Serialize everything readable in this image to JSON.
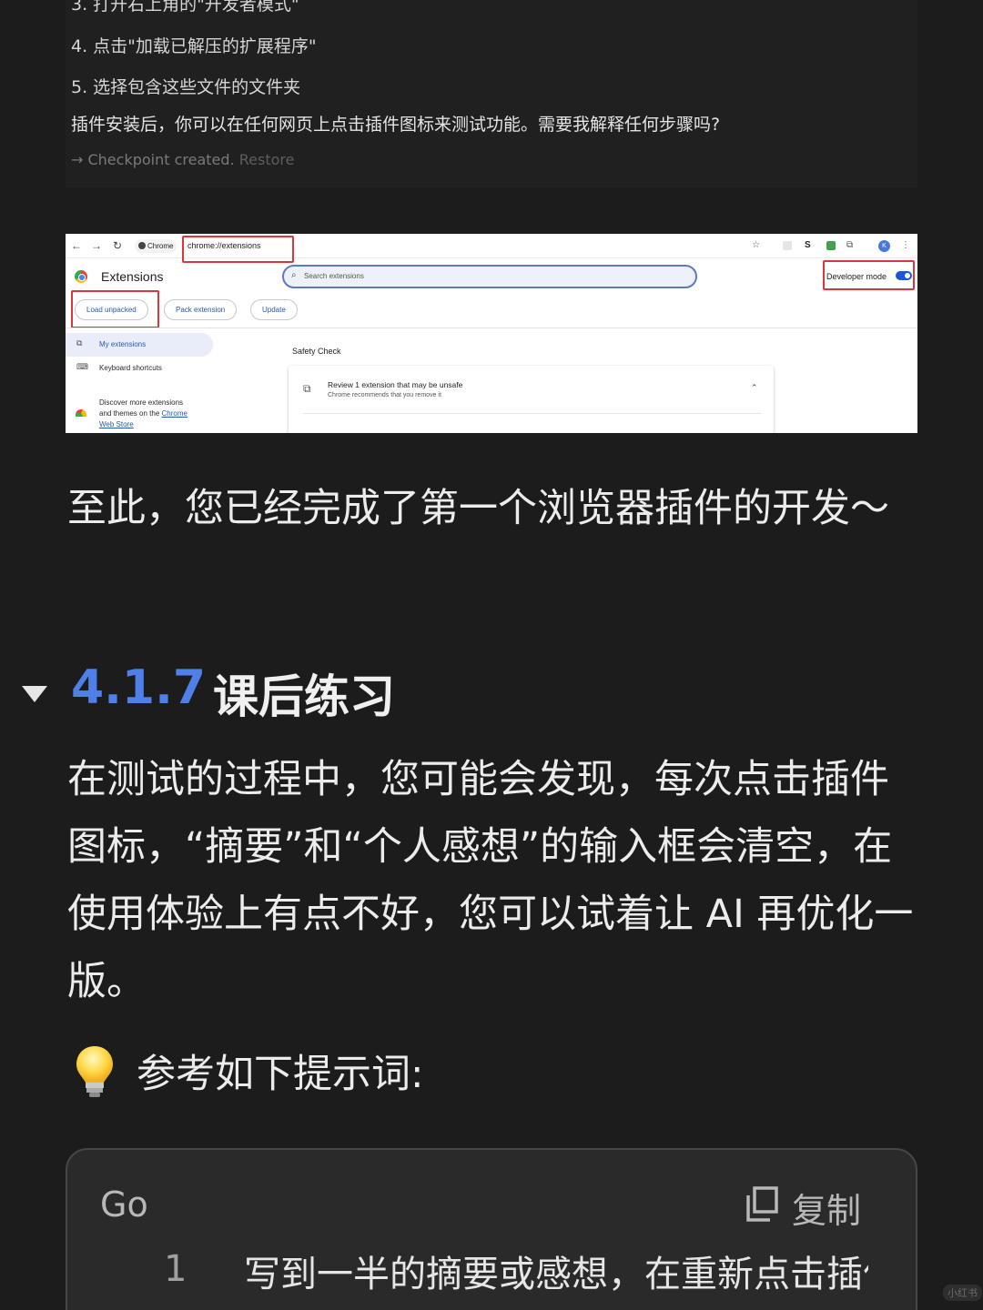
{
  "chat": {
    "lines": [
      "3. 打开右上角的\"开发者模式\"",
      "4. 点击\"加载已解压的扩展程序\"",
      "5. 选择包含这些文件的文件夹",
      "插件安装后，你可以在任何网页上点击插件图标来测试功能。需要我解释任何步骤吗?"
    ],
    "checkpoint": "→ Checkpoint created.",
    "restore": "Restore"
  },
  "browser": {
    "chrome_chip": "Chrome",
    "url": "chrome://extensions",
    "page_title": "Extensions",
    "search_placeholder": "Search extensions",
    "developer_mode": "Developer mode",
    "buttons": [
      "Load unpacked",
      "Pack extension",
      "Update"
    ],
    "sidebar": {
      "my_extensions": "My extensions",
      "keyboard_shortcuts": "Keyboard shortcuts",
      "discover_1": "Discover more extensions",
      "discover_2": "and themes on the",
      "discover_link_1": "Chrome",
      "discover_link_2": "Web Store"
    },
    "safety_check": "Safety Check",
    "review_title": "Review 1 extension that may be unsafe",
    "review_sub": "Chrome recommends that you remove it"
  },
  "article": {
    "para1": "至此，您已经完成了第一个浏览器插件的开发～",
    "heading_num": "4.1.7",
    "heading_title": "课后练习",
    "para2": "在测试的过程中，您可能会发现，每次点击插件图标，“摘要”和“个人感想”的输入框会清空，在使用体验上有点不好，您可以试着让 AI 再优化一版。",
    "tip": "参考如下提示词:"
  },
  "code": {
    "lang": "Go",
    "copy": "复制",
    "line_no": "1",
    "line_text": "写到一半的摘要或感想，在重新点击插件图标后"
  },
  "watermark": "小红书",
  "colors": {
    "background": "#1c1c1c",
    "accent_blue": "#4f7fe8",
    "highlight_red": "#d9363e"
  }
}
